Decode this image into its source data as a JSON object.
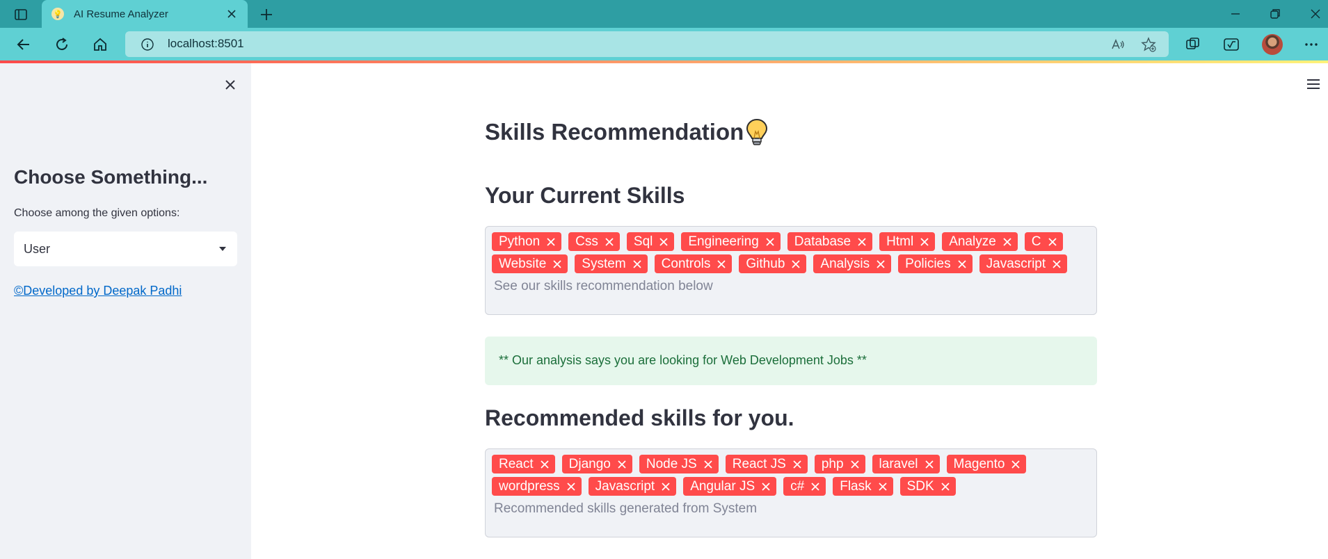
{
  "browser": {
    "tab_title": "AI Resume Analyzer",
    "url": "localhost:8501"
  },
  "sidebar": {
    "heading": "Choose Something...",
    "select_label": "Choose among the given options:",
    "select_value": "User",
    "footer_link": "©Developed by Deepak Padhi"
  },
  "main": {
    "page_title": "Skills Recommendation",
    "current_skills": {
      "heading": "Your Current Skills",
      "tags": [
        "Python",
        "Css",
        "Sql",
        "Engineering",
        "Database",
        "Html",
        "Analyze",
        "C",
        "Website",
        "System",
        "Controls",
        "Github",
        "Analysis",
        "Policies",
        "Javascript"
      ],
      "placeholder": "See our skills recommendation below"
    },
    "analysis_message": "** Our analysis says you are looking for Web Development Jobs **",
    "recommended_skills": {
      "heading": "Recommended skills for you.",
      "tags": [
        "React",
        "Django",
        "Node JS",
        "React JS",
        "php",
        "laravel",
        "Magento",
        "wordpress",
        "Javascript",
        "Angular JS",
        "c#",
        "Flask",
        "SDK"
      ],
      "placeholder": "Recommended skills generated from System"
    }
  },
  "colors": {
    "tag_bg": "#ff4b4b",
    "sidebar_bg": "#f0f2f6",
    "success_bg": "#e6f7ec",
    "success_text": "#1b6e3a",
    "link": "#0068c9",
    "chrome_tabbar": "#2e9ea3",
    "chrome_toolbar": "#5fd0d3"
  },
  "icons": {
    "tag_remove": "close-icon",
    "sidebar_close": "close-icon",
    "menu": "hamburger-icon",
    "title_emoji": "lightbulb-icon"
  }
}
